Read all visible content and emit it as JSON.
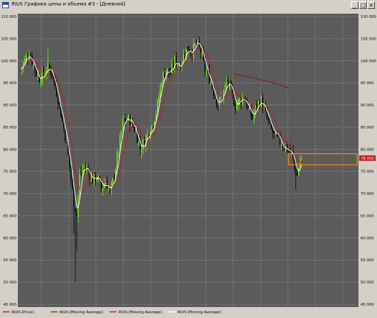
{
  "window": {
    "title": "RIUS Графики цены и объема #3 - [Дневной]",
    "minimize_glyph": "_",
    "maximize_glyph": "□",
    "close_glyph": "×"
  },
  "chart_data": {
    "type": "candlestick",
    "title": "",
    "xlabel": "",
    "ylabel": "",
    "ylim": [
      45000,
      110000
    ],
    "y_ticks": [
      45000,
      50000,
      55000,
      60000,
      65000,
      70000,
      75000,
      80000,
      85000,
      90000,
      95000,
      100000,
      105000,
      110000
    ],
    "y_tick_labels": [
      "45 000",
      "50 000",
      "55 000",
      "60 000",
      "65 000",
      "70 000",
      "75 000",
      "80 000",
      "85 000",
      "90 000",
      "95 000",
      "100 000",
      "105 000",
      "110 000"
    ],
    "grid": true,
    "last_price_label": "78 000",
    "legend": [
      "RIUS [Price]",
      "RIUS [Moving Average]",
      "RIUS [Moving Average]",
      "RIUS [Moving Average]"
    ],
    "colors": {
      "background": "#5b5b5b",
      "grid": "#a8a8a8",
      "bull_candle": "#7cf000",
      "bear_candle": "#000000",
      "ma_red": "#c41a1a",
      "ma_white": "#ffffff",
      "ma_dark_red": "#8b1a1a",
      "highlight_box": "#ff8c00",
      "last_price_bg": "#c41a1a"
    },
    "anchors": [
      [
        0,
        98000
      ],
      [
        3,
        100000
      ],
      [
        6,
        102000
      ],
      [
        10,
        98000
      ],
      [
        13,
        96000
      ],
      [
        16,
        97000
      ],
      [
        19,
        98500
      ],
      [
        22,
        97000
      ],
      [
        25,
        93000
      ],
      [
        28,
        88000
      ],
      [
        31,
        83000
      ],
      [
        34,
        76000
      ],
      [
        37,
        68000
      ],
      [
        39,
        65000
      ],
      [
        41,
        74000
      ],
      [
        44,
        76000
      ],
      [
        47,
        75000
      ],
      [
        50,
        73000
      ],
      [
        53,
        74000
      ],
      [
        56,
        71000
      ],
      [
        59,
        73000
      ],
      [
        62,
        70000
      ],
      [
        65,
        74000
      ],
      [
        68,
        80000
      ],
      [
        71,
        86000
      ],
      [
        74,
        87000
      ],
      [
        77,
        86000
      ],
      [
        80,
        84000
      ],
      [
        83,
        80000
      ],
      [
        86,
        82000
      ],
      [
        89,
        84000
      ],
      [
        92,
        86000
      ],
      [
        95,
        90000
      ],
      [
        98,
        96000
      ],
      [
        101,
        98000
      ],
      [
        104,
        97000
      ],
      [
        107,
        100000
      ],
      [
        110,
        99000
      ],
      [
        113,
        101000
      ],
      [
        116,
        103000
      ],
      [
        119,
        102000
      ],
      [
        122,
        104000
      ],
      [
        125,
        102000
      ],
      [
        128,
        98000
      ],
      [
        131,
        96000
      ],
      [
        134,
        93000
      ],
      [
        137,
        90000
      ],
      [
        140,
        92000
      ],
      [
        143,
        95000
      ],
      [
        146,
        93000
      ],
      [
        149,
        90000
      ],
      [
        152,
        91000
      ],
      [
        155,
        92000
      ],
      [
        158,
        89000
      ],
      [
        161,
        87000
      ],
      [
        164,
        90000
      ],
      [
        167,
        91000
      ],
      [
        170,
        88000
      ],
      [
        173,
        85000
      ],
      [
        176,
        83000
      ],
      [
        179,
        82000
      ],
      [
        182,
        81000
      ],
      [
        185,
        80000
      ],
      [
        188,
        79000
      ],
      [
        190,
        76000
      ],
      [
        192,
        74000
      ],
      [
        194,
        78000
      ]
    ],
    "spikes": [
      {
        "index": 38,
        "low": 50000
      },
      {
        "index": 39,
        "low": 57000
      },
      {
        "index": 37,
        "low": 61000
      },
      {
        "index": 191,
        "low": 71000
      },
      {
        "index": 19,
        "high": 103000
      }
    ],
    "dark_red_ma": [
      {
        "x": 148,
        "y": 97000
      },
      {
        "x": 158,
        "y": 96400
      },
      {
        "x": 168,
        "y": 95600
      },
      {
        "x": 178,
        "y": 94800
      },
      {
        "x": 186,
        "y": 93800
      }
    ],
    "highlight_range": [
      76500,
      79000
    ]
  }
}
